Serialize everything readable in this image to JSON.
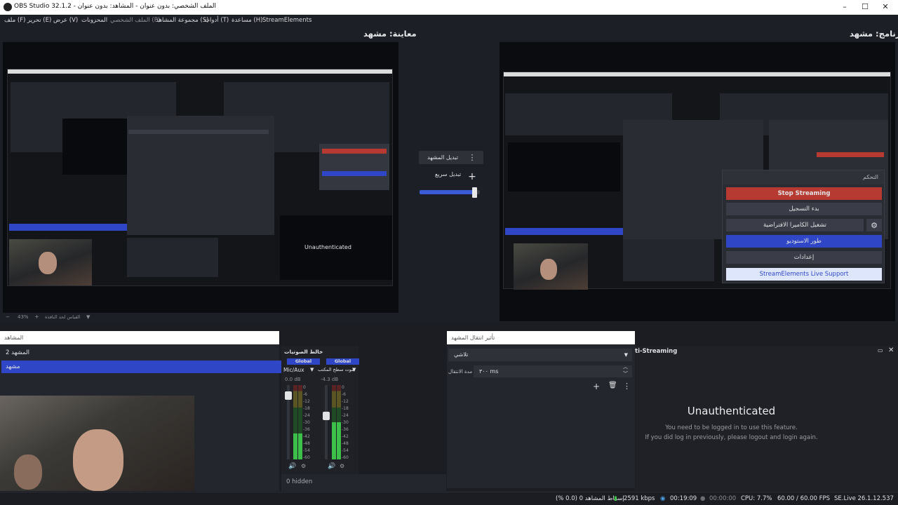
{
  "window": {
    "title": "OBS Studio 32.1.2 - الملف الشخصي: بدون عنوان - المشاهد: بدون عنوان",
    "minimize": "–",
    "maximize": "☐",
    "close": "✕"
  },
  "menu": [
    "ملف (F)",
    "تحرير (E)",
    "عرض (V)",
    "المحزونات",
    "الملف الشخصي (P)",
    "مجموعة المشاهد (S)",
    "أدوات (T)",
    "مساعدة (H)",
    "StreamElements"
  ],
  "preview": {
    "title": "معاينة: مشهد"
  },
  "program": {
    "title": "برنامج: مشهد"
  },
  "transition_controls": {
    "switch_label": "تبديل المشهد",
    "quick_label": "تبديل سريع",
    "more_icon": "⋮",
    "add_icon": "+",
    "tbar_level": 0.95
  },
  "zoom": {
    "value": "43%",
    "fit_label": "القياس لحد النافذة"
  },
  "controls_panel": {
    "title": "التحكم",
    "stop_streaming": "Stop Streaming",
    "start_recording": "بدء التسجيل",
    "virtual_camera": "تشغيل الكاميرا الافتراضية",
    "studio_mode": "طور الاستوديو",
    "settings": "إعدادات",
    "se_support": "StreamElements Live Support",
    "gear_icon": "⚙"
  },
  "scenes": {
    "title": "المشاهد",
    "items": [
      {
        "name": "المشهد 2",
        "selected": false
      },
      {
        "name": "مشهد",
        "selected": true
      }
    ]
  },
  "mixer": {
    "title": "خالط الصوتيات",
    "channels": [
      {
        "badge": "Global",
        "name": "Mic/Aux",
        "db": "0.0 dB",
        "level": 0.35,
        "fader": 0.9
      },
      {
        "badge": "Global",
        "name": "صوت سطح المكتب",
        "db": "-4.3 dB",
        "level": 0.5,
        "fader": 0.6
      }
    ],
    "scale": [
      "0",
      "-6",
      "-12",
      "-18",
      "-24",
      "-30",
      "-36",
      "-42",
      "-48",
      "-54",
      "-60"
    ],
    "hidden": "0 hidden"
  },
  "transitions": {
    "title": "تأثير انتقال المشهد",
    "selected": "تلاشي",
    "duration_label": "مدة الانتقال",
    "duration_value": "٣٠٠ ms"
  },
  "se_dock": {
    "title": "ti-Streaming",
    "heading": "Unauthenticated",
    "line1": "You need to be logged in to use this feature.",
    "line2": "If you did log in previously, please logout and login again."
  },
  "status": {
    "dropped": "إسقاط المشاهد 0 (0.0 %)",
    "bitrate": "2591 kbps",
    "stream_time": "00:19:09",
    "rec_time": "00:00:00",
    "cpu": "CPU: 7.7%",
    "fps": "60.00 / 60.00 FPS",
    "version": "SE.Live 26.1.12.537"
  },
  "colors": {
    "accent": "#2f47c6",
    "stop": "#b73a32",
    "support": "#dde6fb"
  }
}
